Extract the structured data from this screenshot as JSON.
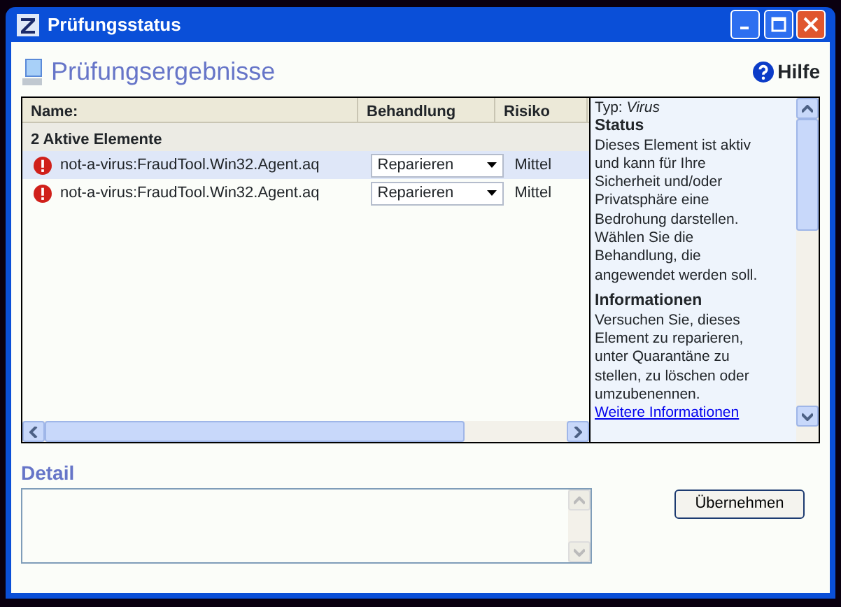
{
  "window": {
    "title": "Prüfungsstatus"
  },
  "heading": "Prüfungsergebnisse",
  "help": "Hilfe",
  "table": {
    "columns": [
      "Name:",
      "Behandlung",
      "Risiko"
    ],
    "group": "2 Aktive Elemente",
    "rows": [
      {
        "name": "not-a-virus:FraudTool.Win32.Agent.aq",
        "treatment": "Reparieren",
        "risk": "Mittel",
        "selected": true
      },
      {
        "name": "not-a-virus:FraudTool.Win32.Agent.aq",
        "treatment": "Reparieren",
        "risk": "Mittel",
        "selected": false
      }
    ]
  },
  "info": {
    "type_label": "Typ:",
    "type_value": "Virus",
    "status_heading": "Status",
    "status_text": "Dieses Element ist aktiv und kann für Ihre Sicherheit und/oder Privatsphäre eine Bedrohung darstellen. Wählen Sie die Behandlung, die angewendet werden soll.",
    "info_heading": "Informationen",
    "info_text": "Versuchen Sie, dieses Element zu reparieren, unter Quarantäne zu stellen, zu löschen oder umzubenennen.",
    "link": "Weitere Informationen"
  },
  "detail": {
    "label": "Detail"
  },
  "apply_button": "Übernehmen"
}
